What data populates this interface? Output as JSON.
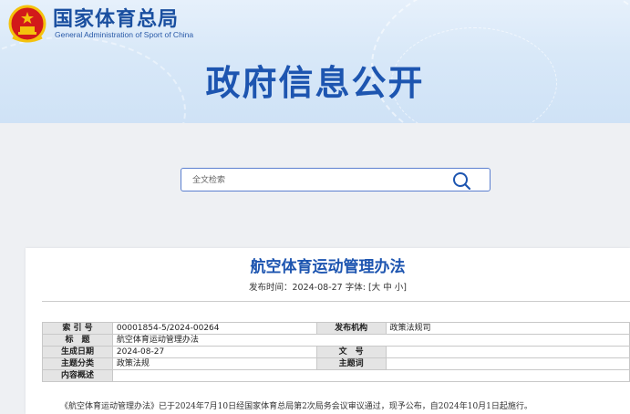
{
  "header": {
    "site_name_cn": "国家体育总局",
    "site_name_en": "General Administration of Sport of China",
    "hero_title": "政府信息公开",
    "emblem_icon": "national-emblem-icon"
  },
  "search": {
    "placeholder": "全文检索",
    "icon": "search-icon"
  },
  "document": {
    "title": "航空体育运动管理办法",
    "publish_prefix": "发布时间：",
    "publish_date": "2024-08-27",
    "font_prefix": " 字体: [",
    "font_large": "大",
    "font_medium": "中",
    "font_small": "小",
    "font_suffix": "]",
    "meta": {
      "index_label": "索 引 号",
      "index_value": "00001854-5/2024-00264",
      "agency_label": "发布机构",
      "agency_value": "政策法规司",
      "title_label": "标　题",
      "title_value": "航空体育运动管理办法",
      "date_label": "生成日期",
      "date_value": "2024-08-27",
      "docno_label": "文　号",
      "docno_value": "",
      "category_label": "主题分类",
      "category_value": "政策法规",
      "keyword_label": "主题词",
      "keyword_value": "",
      "summary_label": "内容概述",
      "summary_value": ""
    },
    "intro": "《航空体育运动管理办法》已于2024年7月10日经国家体育总局第2次局务会议审议通过，现予公布，自2024年10月1日起施行。"
  },
  "colors": {
    "brand_blue": "#1d55b0",
    "emblem_red": "#d21a1a",
    "emblem_gold": "#f4c20d"
  }
}
